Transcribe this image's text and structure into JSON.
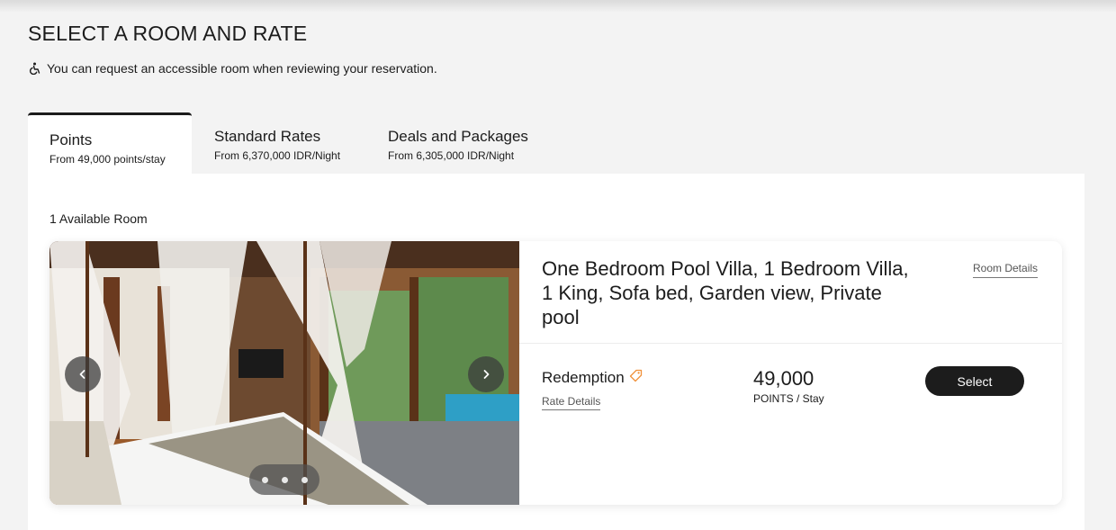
{
  "page": {
    "title": "SELECT A ROOM AND RATE",
    "accessibility_note": "You can request an accessible room when reviewing your reservation.",
    "accessibility_icon": "wheelchair-icon"
  },
  "tabs": [
    {
      "label": "Points",
      "sublabel": "From 49,000 points/stay",
      "active": true
    },
    {
      "label": "Standard Rates",
      "sublabel": "From 6,370,000 IDR/Night",
      "active": false
    },
    {
      "label": "Deals and Packages",
      "sublabel": "From 6,305,000 IDR/Night",
      "active": false
    }
  ],
  "results": {
    "available_count_label": "1 Available Room"
  },
  "room": {
    "name": "One Bedroom Pool Villa, 1 Bedroom Villa, 1 King, Sofa bed, Garden view, Private pool",
    "details_link": "Room Details",
    "carousel": {
      "prev_icon": "chevron-left-icon",
      "next_icon": "chevron-right-icon",
      "dots": 3
    },
    "rate": {
      "name": "Redemption",
      "tag_icon": "tag-icon",
      "details_link": "Rate Details",
      "price": "49,000",
      "unit_strong": "POINTS",
      "unit_rest": " / Stay",
      "select_label": "Select"
    }
  },
  "colors": {
    "background": "#f3f3f3",
    "panel": "#ffffff",
    "button": "#1c1c1c",
    "tag_accent": "#f0913a"
  }
}
